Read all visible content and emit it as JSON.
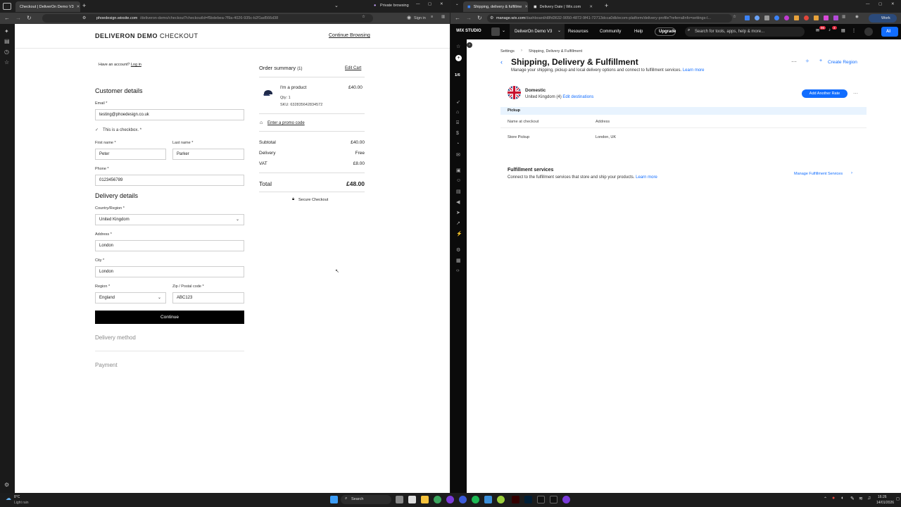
{
  "left_browser": {
    "tab_title": "Checkout | DeliverOn Demo V3",
    "private_label": "Private browsing",
    "url_host": "phoedesign.wixsite.com",
    "url_path": "/deliveron-demo/checkout?checkoutId=f5bdebea-7f9a-4026-935c-b2f1ad566d38",
    "sign_in": "Sign in"
  },
  "checkout": {
    "brand_bold": "DELIVERON DEMO",
    "brand_light": "CHECKOUT",
    "continue_browsing": "Continue Browsing",
    "have_account": "Have an account?",
    "login": "Log in",
    "customer_details": "Customer details",
    "email_label": "Email *",
    "email_value": "testing@phoedesign.co.uk",
    "checkbox_label": "This is a checkbox. *",
    "first_name_label": "First name *",
    "first_name_value": "Peter",
    "last_name_label": "Last name *",
    "last_name_value": "Parker",
    "phone_label": "Phone *",
    "phone_value": "0123456789",
    "delivery_details": "Delivery details",
    "country_label": "Country/Region *",
    "country_value": "United Kingdom",
    "address_label": "Address *",
    "address_value": "London",
    "city_label": "City *",
    "city_value": "London",
    "region_label": "Region *",
    "region_value": "England",
    "zip_label": "Zip / Postal code *",
    "zip_value": "ABC123",
    "continue_btn": "Continue",
    "delivery_method": "Delivery method",
    "payment": "Payment"
  },
  "order_summary": {
    "title": "Order summary",
    "count": "(1)",
    "edit_cart": "Edit Cart",
    "product_name": "I'm a product",
    "product_price": "£40.00",
    "qty": "Qty: 1",
    "sku": "SKU: 632835642834572",
    "promo": "Enter a promo code",
    "subtotal_label": "Subtotal",
    "subtotal_value": "£40.00",
    "delivery_label": "Delivery",
    "delivery_value": "Free",
    "vat_label": "VAT",
    "vat_value": "£8.00",
    "total_label": "Total",
    "total_value": "£48.00",
    "secure": "Secure Checkout"
  },
  "right_browser": {
    "tab1_title": "Shipping, delivery & fulfillme",
    "tab2_title": "Delivery Date | Wix.com",
    "url_host": "manage.wix.com",
    "url_path": "/dashboard/d8fd3632-9050-4872-9f41-72713dcca0db/ecom-platform/delivery-profile?referralInfo=settings-l...",
    "work_label": "Work"
  },
  "wix": {
    "logo": "WIX STUDIO",
    "site_name": "DeliverOn Demo V3",
    "nav_resources": "Resources",
    "nav_community": "Community",
    "nav_help": "Help",
    "upgrade": "Upgrade",
    "search_placeholder": "Search for tools, apps, help & more...",
    "badge1": "96",
    "badge2": "3",
    "ai_label": "AI",
    "progress": "1/6",
    "breadcrumb_root": "Settings",
    "breadcrumb_current": "Shipping, Delivery & Fulfillment",
    "page_title": "Shipping, Delivery & Fulfillment",
    "page_desc": "Manage your shipping, pickup and local delivery options and connect to fulfillment services.",
    "learn_more": "Learn more",
    "create_region": "Create Region",
    "region_name": "Domestic",
    "region_country": "United Kingdom (4)",
    "edit_destinations": "Edit destinations",
    "add_rate": "Add Another Rate",
    "pickup_header": "Pickup",
    "col_name": "Name at checkout",
    "col_address": "Address",
    "pickup_name": "Store Pickup",
    "pickup_address": "London, UK",
    "fulfillment_title": "Fulfillment services",
    "fulfillment_desc": "Connect to the fulfillment services that store and ship your products.",
    "fulfillment_learn": "Learn more",
    "manage_fulfillment": "Manage Fulfillment Services"
  },
  "taskbar": {
    "weather_temp": "8°C",
    "weather_desc": "Light rain",
    "search": "Search",
    "time": "16:26",
    "date": "14/01/2026"
  },
  "colors": {
    "wix_blue": "#116dff",
    "black_button": "#000000",
    "pickup_bg": "#e8f3fe"
  }
}
